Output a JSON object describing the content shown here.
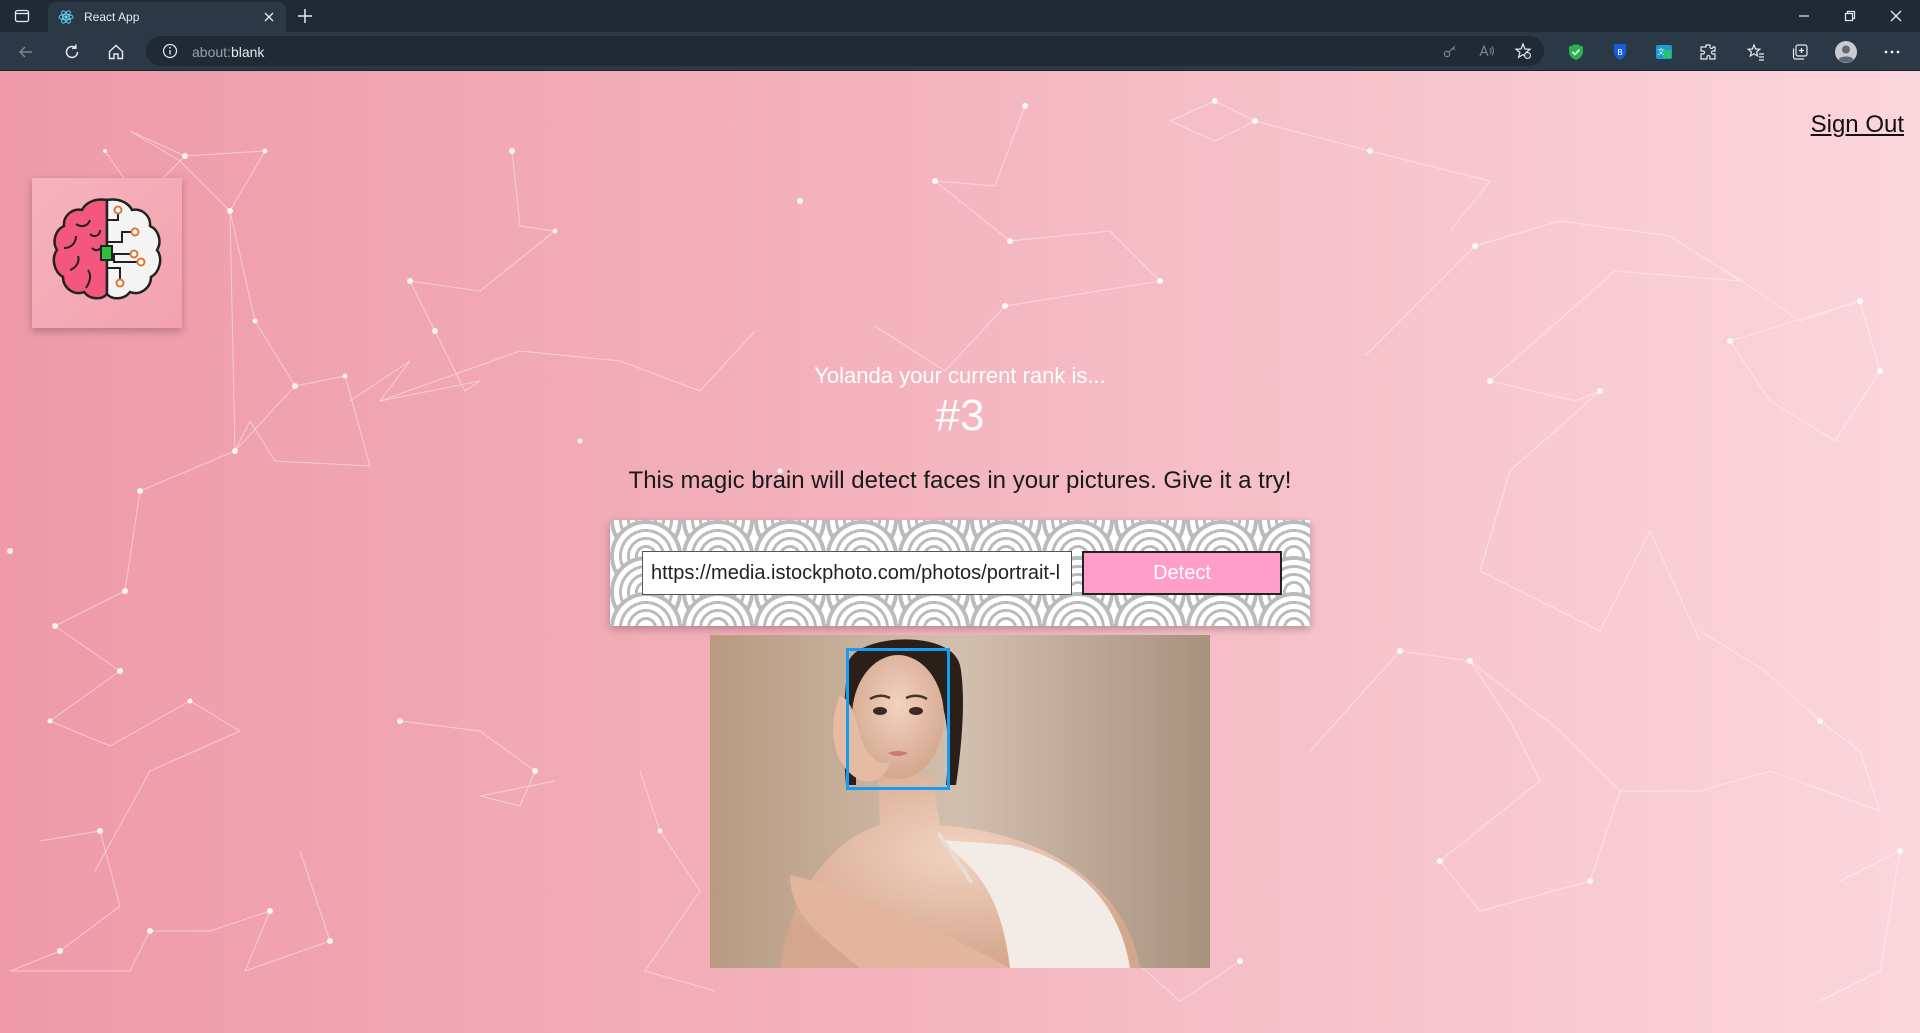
{
  "browser": {
    "tab_title": "React App",
    "address_scheme": "about:",
    "address_page": "blank"
  },
  "header": {
    "sign_out_label": "Sign Out"
  },
  "main": {
    "rank_message": "Yolanda your current rank is...",
    "rank_value": "#3",
    "tagline": "This magic brain will detect faces in your pictures. Give it a try!",
    "image_url_input_value": "https://media.istockphoto.com/photos/portrait-l",
    "detect_button_label": "Detect"
  },
  "colors": {
    "detect_button": "#ff9fc9",
    "face_box": "#149df2",
    "background_left": "#ee9aa7",
    "background_right": "#fbd6dc"
  },
  "icons": [
    "tab-switcher-icon",
    "react-favicon",
    "tab-close-icon",
    "new-tab-icon",
    "back-icon",
    "refresh-icon",
    "home-icon",
    "info-icon",
    "brain-logo-icon",
    "shield-extension-icon",
    "extensions-icon",
    "favorites-icon",
    "collections-icon",
    "profile-icon",
    "more-icon"
  ]
}
